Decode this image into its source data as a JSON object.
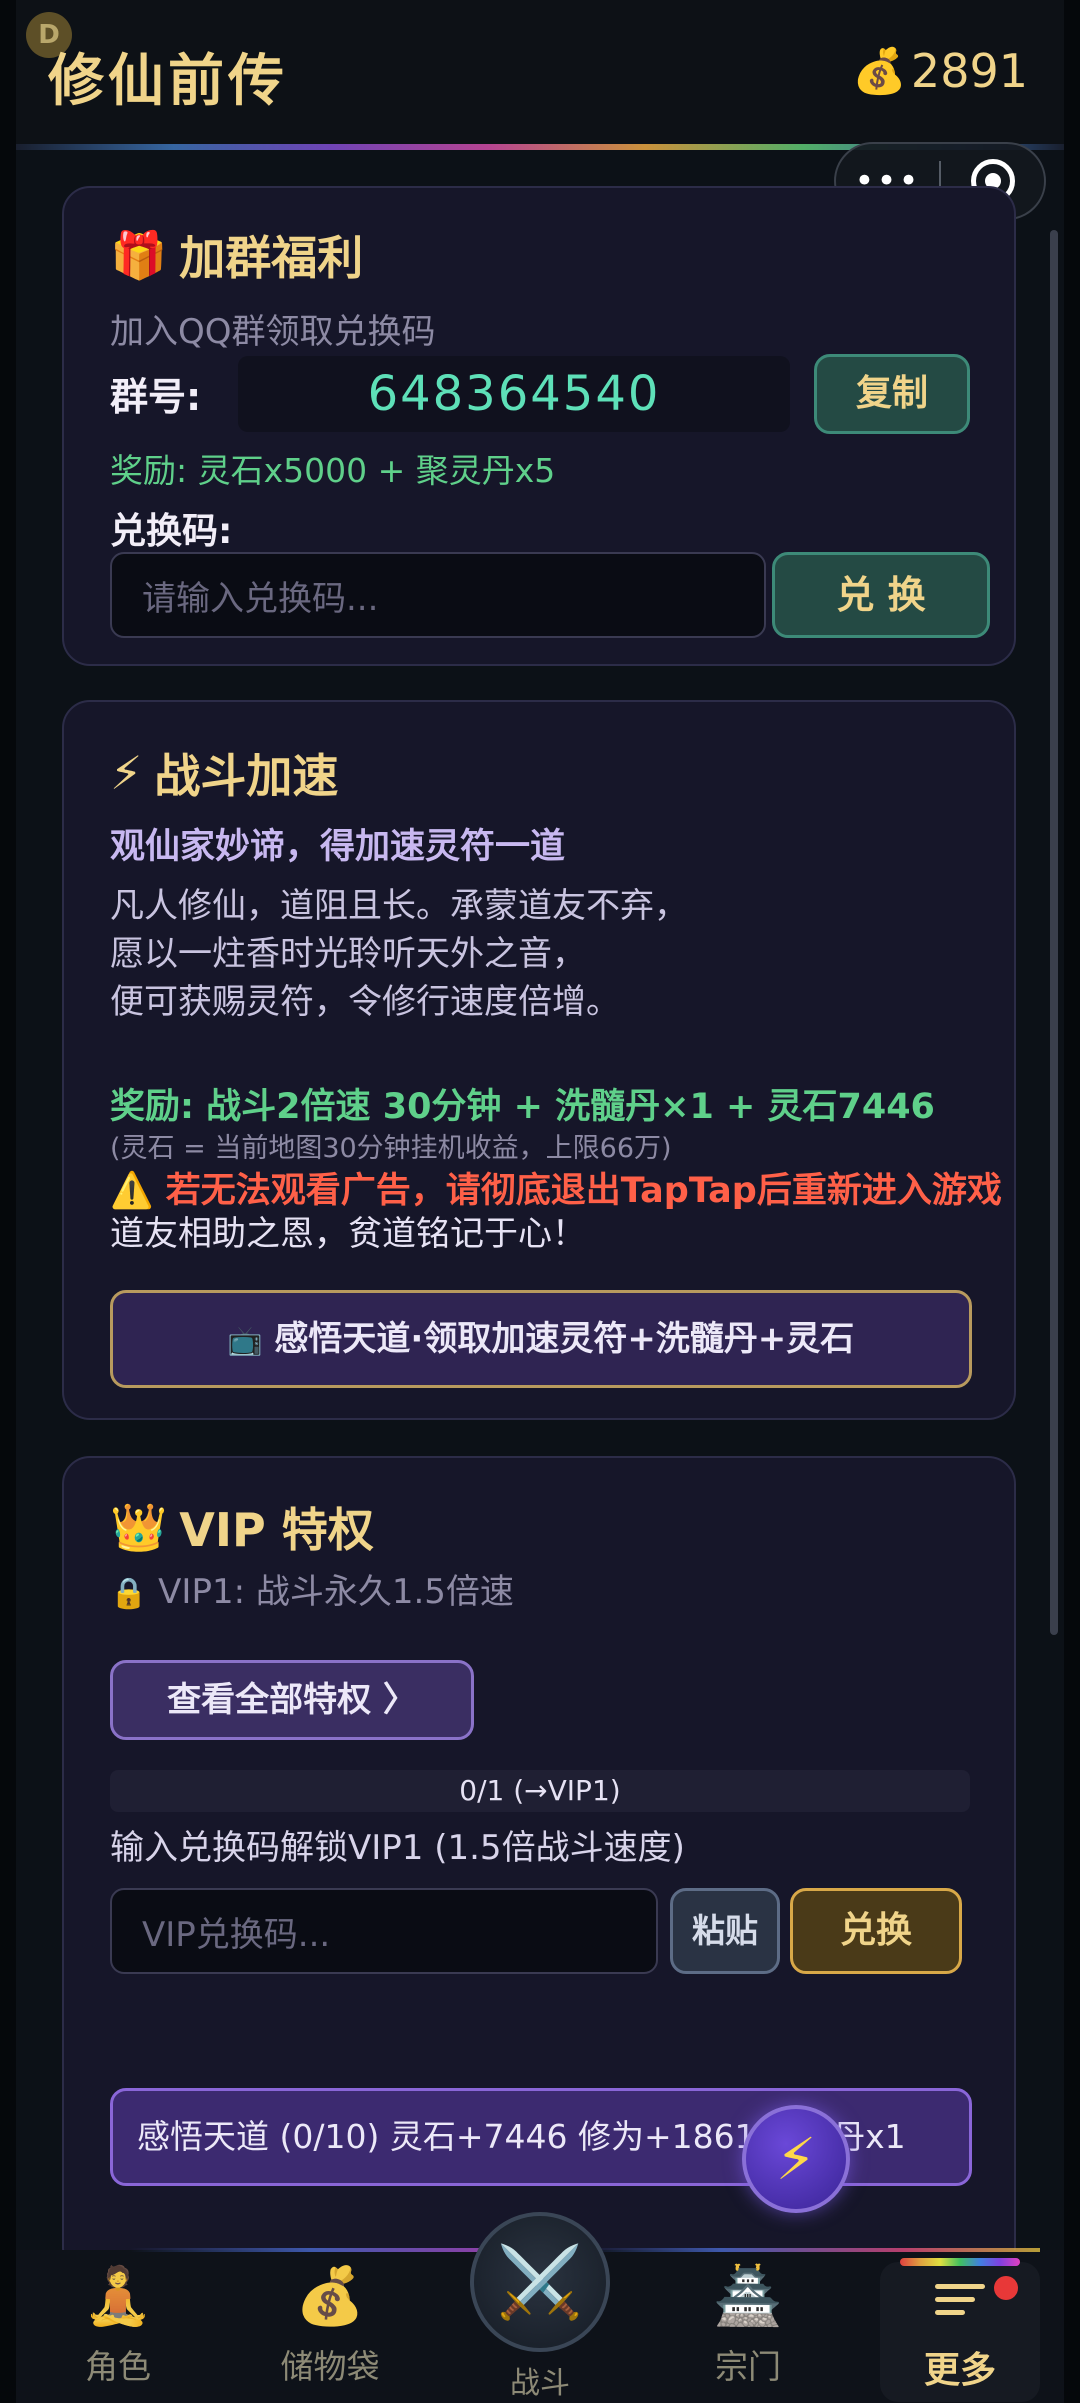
{
  "header": {
    "badge": "D",
    "title": "修仙前传",
    "coins_icon": "💰",
    "coins": "2891"
  },
  "capsule": {
    "more": "•••"
  },
  "group_card": {
    "icon": "🎁",
    "title": "加群福利",
    "subtitle": "加入QQ群领取兑换码",
    "group_label": "群号:",
    "group_number": "648364540",
    "copy_button": "复制",
    "reward": "奖励: 灵石x5000 + 聚灵丹x5",
    "code_label": "兑换码:",
    "code_placeholder": "请输入兑换码...",
    "redeem_button": "兑 换"
  },
  "speed_card": {
    "icon": "⚡",
    "title": "战斗加速",
    "headline": "观仙家妙谛，得加速灵符一道",
    "lines": [
      "凡人修仙，道阻且长。承蒙道友不弃，",
      "愿以一炷香时光聆听天外之音，",
      "便可获赐灵符，令修行速度倍增。"
    ],
    "reward": "奖励: 战斗2倍速 30分钟 + 洗髓丹×1 + 灵石7446",
    "note": "(灵石 = 当前地图30分钟挂机收益，上限66万)",
    "warning_icon": "⚠️",
    "warning": "若无法观看广告，请彻底退出TapTap后重新进入游戏",
    "thanks": "道友相助之恩，贫道铭记于心！",
    "claim_icon": "📺",
    "claim_button": "感悟天道·领取加速灵符+洗髓丹+灵石"
  },
  "vip_card": {
    "icon": "👑",
    "title": "VIP 特权",
    "lock_icon": "🔒",
    "status": "VIP1: 战斗永久1.5倍速",
    "view_all_button": "查看全部特权 〉",
    "progress": 0,
    "progress_text": "0/1 (→VIP1)",
    "hint": "输入兑换码解锁VIP1 (1.5倍战斗速度)",
    "code_placeholder": "VIP兑换码...",
    "paste_button": "粘贴",
    "redeem_button": "兑换",
    "insight_button": "感悟天道 (0/10)  灵石+7446 修为+1861  续命丹x1"
  },
  "float_button": {
    "icon": "⚡"
  },
  "nav": {
    "items": [
      {
        "label": "角色",
        "icon": "🧘"
      },
      {
        "label": "储物袋",
        "icon": "💰"
      },
      {
        "label": "战斗",
        "icon": "⚔️"
      },
      {
        "label": "宗门",
        "icon": "🏯"
      },
      {
        "label": "更多",
        "icon": "menu"
      }
    ]
  },
  "colors": {
    "gold": "#f0d48a",
    "green": "#5fd08a",
    "warning": "#ff6048",
    "card_bg": "#161629",
    "background": "#0c1117"
  }
}
